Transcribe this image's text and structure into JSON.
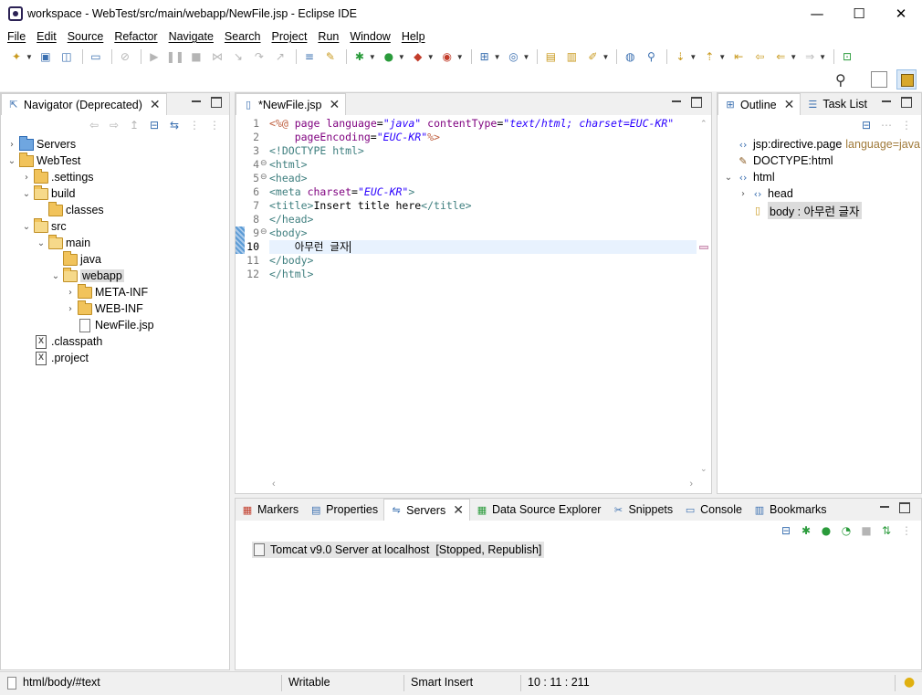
{
  "window": {
    "title": "workspace - WebTest/src/main/webapp/NewFile.jsp - Eclipse IDE",
    "minimize": "—",
    "maximize": "☐",
    "close": "✕"
  },
  "menu": [
    "File",
    "Edit",
    "Source",
    "Refactor",
    "Navigate",
    "Search",
    "Project",
    "Run",
    "Window",
    "Help"
  ],
  "navigator": {
    "tab_label": "Navigator (Deprecated)",
    "tree": [
      {
        "label": "Servers",
        "indent": 0,
        "chevron": "›",
        "icon": "servers"
      },
      {
        "label": "WebTest",
        "indent": 0,
        "chevron": "⌄",
        "icon": "project"
      },
      {
        "label": ".settings",
        "indent": 1,
        "chevron": "›",
        "icon": "folder"
      },
      {
        "label": "build",
        "indent": 1,
        "chevron": "⌄",
        "icon": "folder"
      },
      {
        "label": "classes",
        "indent": 2,
        "chevron": "",
        "icon": "folder"
      },
      {
        "label": "src",
        "indent": 1,
        "chevron": "⌄",
        "icon": "folder"
      },
      {
        "label": "main",
        "indent": 2,
        "chevron": "⌄",
        "icon": "folder"
      },
      {
        "label": "java",
        "indent": 3,
        "chevron": "",
        "icon": "folder"
      },
      {
        "label": "webapp",
        "indent": 3,
        "chevron": "⌄",
        "icon": "folder",
        "selected": true
      },
      {
        "label": "META-INF",
        "indent": 4,
        "chevron": "›",
        "icon": "folder"
      },
      {
        "label": "WEB-INF",
        "indent": 4,
        "chevron": "›",
        "icon": "folder"
      },
      {
        "label": "NewFile.jsp",
        "indent": 4,
        "chevron": "",
        "icon": "file"
      },
      {
        "label": ".classpath",
        "indent": 1,
        "chevron": "",
        "icon": "xfile"
      },
      {
        "label": ".project",
        "indent": 1,
        "chevron": "",
        "icon": "xfile"
      }
    ]
  },
  "editor": {
    "tab_label": "*NewFile.jsp",
    "line_numbers": [
      "1",
      "2",
      "3",
      "4",
      "5",
      "6",
      "7",
      "8",
      "9",
      "10",
      "11",
      "12"
    ],
    "current_line": 10
  },
  "outline": {
    "tab_label": "Outline",
    "task_list_label": "Task List",
    "items": [
      {
        "label": "jsp:directive.page",
        "extra": "language=java",
        "indent": 0,
        "chevron": ""
      },
      {
        "label": "DOCTYPE:html",
        "extra": "",
        "indent": 0,
        "chevron": ""
      },
      {
        "label": "html",
        "extra": "",
        "indent": 0,
        "chevron": "⌄"
      },
      {
        "label": "head",
        "extra": "",
        "indent": 1,
        "chevron": "›"
      },
      {
        "label": "body : 아무런 글자",
        "extra": "",
        "indent": 1,
        "chevron": "",
        "selected": true
      }
    ]
  },
  "bottom": {
    "tabs": [
      "Markers",
      "Properties",
      "Servers",
      "Data Source Explorer",
      "Snippets",
      "Console",
      "Bookmarks"
    ],
    "active_tab": "Servers",
    "server_entry": "Tomcat v9.0 Server at localhost  [Stopped, Republish]"
  },
  "status": {
    "path": "html/body/#text",
    "mode": "Writable",
    "insert": "Smart Insert",
    "position": "10 : 11 : 211"
  }
}
